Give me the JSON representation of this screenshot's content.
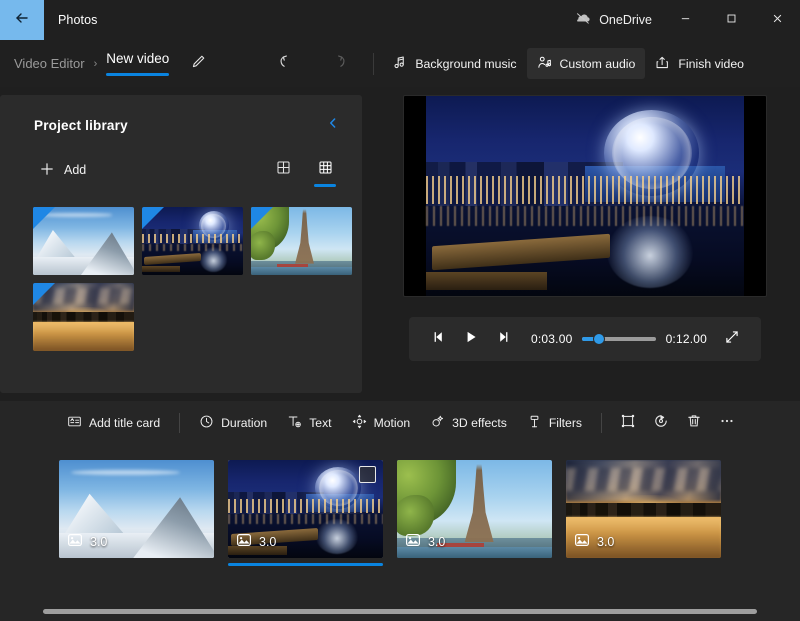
{
  "titlebar": {
    "back_icon": "back-arrow-icon",
    "app_title": "Photos",
    "onedrive_label": "OneDrive",
    "onedrive_icon": "onedrive-cloud-icon",
    "minimize_icon": "minimize-icon",
    "maximize_icon": "maximize-icon",
    "close_icon": "close-icon"
  },
  "commandbar": {
    "breadcrumb_parent": "Video Editor",
    "breadcrumb_separator": "›",
    "breadcrumb_current": "New video",
    "rename_icon": "pencil-icon",
    "undo_icon": "undo-icon",
    "redo_icon": "redo-icon",
    "buttons": [
      {
        "label": "Background music",
        "icon": "music-note-icon",
        "active": false
      },
      {
        "label": "Custom audio",
        "icon": "person-audio-icon",
        "active": true
      },
      {
        "label": "Finish video",
        "icon": "export-share-icon",
        "active": false
      }
    ],
    "overflow_label": "• • •"
  },
  "library": {
    "title": "Project library",
    "collapse_icon": "chevron-left-icon",
    "add_label": "Add",
    "add_icon": "plus-icon",
    "view_large_icon": "grid-2x2-icon",
    "view_small_icon": "grid-3x3-icon",
    "view_selected": "grid-3x3-icon",
    "items": [
      {
        "name": "snowy-mountain",
        "style": "ph-mtn"
      },
      {
        "name": "vancouver-science-world",
        "style": "ph-van"
      },
      {
        "name": "eiffel-tower",
        "style": "ph-eif"
      },
      {
        "name": "sunset-city-skyline",
        "style": "ph-sun"
      }
    ]
  },
  "preview": {
    "current_frame": "vancouver-science-world",
    "prev_frame_icon": "previous-frame-icon",
    "play_icon": "play-icon",
    "next_frame_icon": "next-frame-icon",
    "current_time": "0:03.00",
    "total_time": "0:12.00",
    "fullscreen_icon": "expand-icon",
    "progress_percent": 22
  },
  "storyboard": {
    "toolbar": [
      {
        "label": "Add title card",
        "icon": "title-card-icon"
      },
      {
        "label": "Duration",
        "icon": "clock-icon"
      },
      {
        "label": "Text",
        "icon": "text-icon"
      },
      {
        "label": "Motion",
        "icon": "motion-icon"
      },
      {
        "label": "3D effects",
        "icon": "3d-effects-icon"
      },
      {
        "label": "Filters",
        "icon": "filters-icon"
      }
    ],
    "icon_buttons": [
      {
        "icon": "crop-resize-icon"
      },
      {
        "icon": "rotate-icon"
      },
      {
        "icon": "delete-trash-icon"
      },
      {
        "icon": "more-options-icon"
      }
    ],
    "clips": [
      {
        "name": "snowy-mountain",
        "style": "ph-mtn",
        "duration": "3.0",
        "badge_icon": "photo-icon",
        "selected": false
      },
      {
        "name": "vancouver-science-world",
        "style": "ph-van",
        "duration": "3.0",
        "badge_icon": "photo-icon",
        "selected": true
      },
      {
        "name": "eiffel-tower",
        "style": "ph-eif",
        "duration": "3.0",
        "badge_icon": "photo-icon",
        "selected": false
      },
      {
        "name": "sunset-city-skyline",
        "style": "ph-sun",
        "duration": "3.0",
        "badge_icon": "photo-icon",
        "selected": false
      }
    ],
    "scrollbar_icon": "horizontal-scrollbar"
  },
  "colors": {
    "accent_blue": "#0a84e0",
    "back_highlight": "#76b9ed",
    "window_bg": "#202020",
    "panel_bg": "#2b2b2b",
    "storyboard_bg": "#262626"
  }
}
